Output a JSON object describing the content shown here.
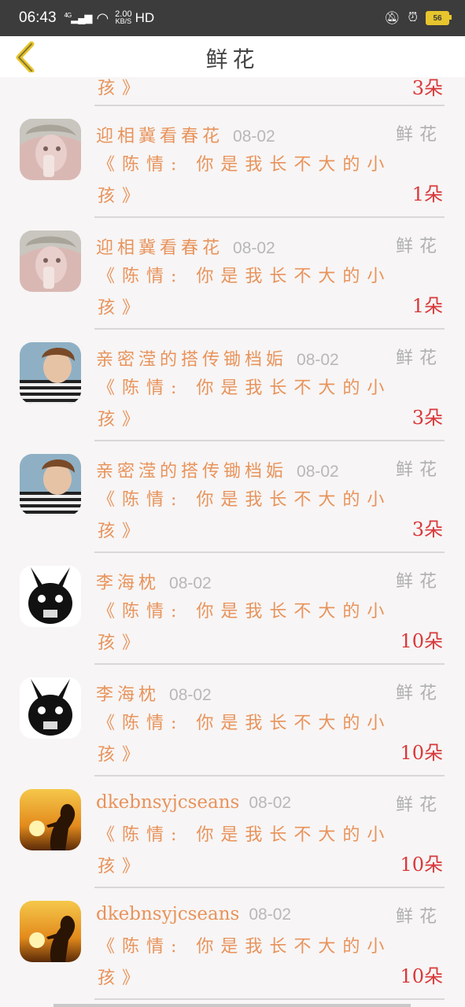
{
  "status": {
    "time": "06:43",
    "signal": "4G",
    "net_speed_value": "2.00",
    "net_speed_unit": "KB/S",
    "hd": "HD",
    "battery": "56"
  },
  "header": {
    "title": "鲜花"
  },
  "partial_item": {
    "content_line2": "孩》",
    "count": "3朵"
  },
  "items": [
    {
      "name": "迎相冀看春花",
      "date": "08-02",
      "type": "鲜花",
      "content_line1": "《陈情: 你是我长不大的小",
      "content_line2": "孩》",
      "count": "1朵",
      "avatar": "anime-girl"
    },
    {
      "name": "迎相冀看春花",
      "date": "08-02",
      "type": "鲜花",
      "content_line1": "《陈情: 你是我长不大的小",
      "content_line2": "孩》",
      "count": "1朵",
      "avatar": "anime-girl"
    },
    {
      "name": "亲密滢的搭传锄档姤",
      "date": "08-02",
      "type": "鲜花",
      "content_line1": "《陈情: 你是我长不大的小",
      "content_line2": "孩》",
      "count": "3朵",
      "avatar": "boy-photo"
    },
    {
      "name": "亲密滢的搭传锄档姤",
      "date": "08-02",
      "type": "鲜花",
      "content_line1": "《陈情: 你是我长不大的小",
      "content_line2": "孩》",
      "count": "3朵",
      "avatar": "boy-photo"
    },
    {
      "name": "李海枕",
      "date": "08-02",
      "type": "鲜花",
      "content_line1": "《陈情: 你是我长不大的小",
      "content_line2": "孩》",
      "count": "10朵",
      "avatar": "rabbit-emblem"
    },
    {
      "name": "李海枕",
      "date": "08-02",
      "type": "鲜花",
      "content_line1": "《陈情: 你是我长不大的小",
      "content_line2": "孩》",
      "count": "10朵",
      "avatar": "rabbit-emblem"
    },
    {
      "name": "dkebnsyjcseans",
      "date": "08-02",
      "type": "鲜花",
      "content_line1": "《陈情: 你是我长不大的小",
      "content_line2": "孩》",
      "count": "10朵",
      "avatar": "sunset-silhouette"
    },
    {
      "name": "dkebnsyjcseans",
      "date": "08-02",
      "type": "鲜花",
      "content_line1": "《陈情: 你是我长不大的小",
      "content_line2": "孩》",
      "count": "10朵",
      "avatar": "sunset-silhouette"
    }
  ],
  "colors": {
    "accent_orange": "#e8935b",
    "count_red": "#d9393b",
    "back_yellow": "#e6c52d"
  }
}
